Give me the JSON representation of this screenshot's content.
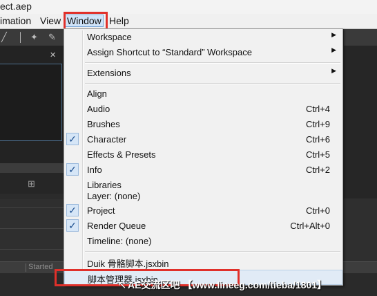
{
  "window": {
    "title_fragment": "ect.aep"
  },
  "menubar": {
    "items": [
      {
        "label": "imation"
      },
      {
        "label": "View"
      },
      {
        "label": "Window"
      },
      {
        "label": "Help"
      }
    ]
  },
  "panels": {
    "render_queue_header": "Started"
  },
  "window_menu": {
    "items": [
      {
        "label": "Workspace",
        "has_submenu": true
      },
      {
        "label": "Assign Shortcut to  “Standard”  Workspace",
        "has_submenu": true
      },
      {
        "label": "Extensions",
        "has_submenu": true
      },
      {
        "label": "Align"
      },
      {
        "label": "Audio",
        "shortcut": "Ctrl+4"
      },
      {
        "label": "Brushes",
        "shortcut": "Ctrl+9"
      },
      {
        "label": "Character",
        "shortcut": "Ctrl+6",
        "checked": true
      },
      {
        "label": "Effects & Presets",
        "shortcut": "Ctrl+5"
      },
      {
        "label": "Info",
        "shortcut": "Ctrl+2",
        "checked": true
      },
      {
        "label": "Libraries"
      },
      {
        "label": "Layer: (none)"
      },
      {
        "label": "Project",
        "shortcut": "Ctrl+0",
        "checked": true
      },
      {
        "label": "Render Queue",
        "shortcut": "Ctrl+Alt+0",
        "checked": true
      },
      {
        "label": "Timeline: (none)"
      },
      {
        "label": "Duik 骨骼脚本.jsxbin"
      },
      {
        "label": "脚本管理器.jsxbin",
        "hovered": true
      }
    ],
    "check_glyph": "✓",
    "submenu_glyph": "▶"
  },
  "watermark": "AE交流区吧 【www.lineeg.com/tieba/1801】",
  "colors": {
    "highlight_box": "#e0302a",
    "menu_bg": "#f1f1f1",
    "check_bg": "#d6e6f7"
  }
}
